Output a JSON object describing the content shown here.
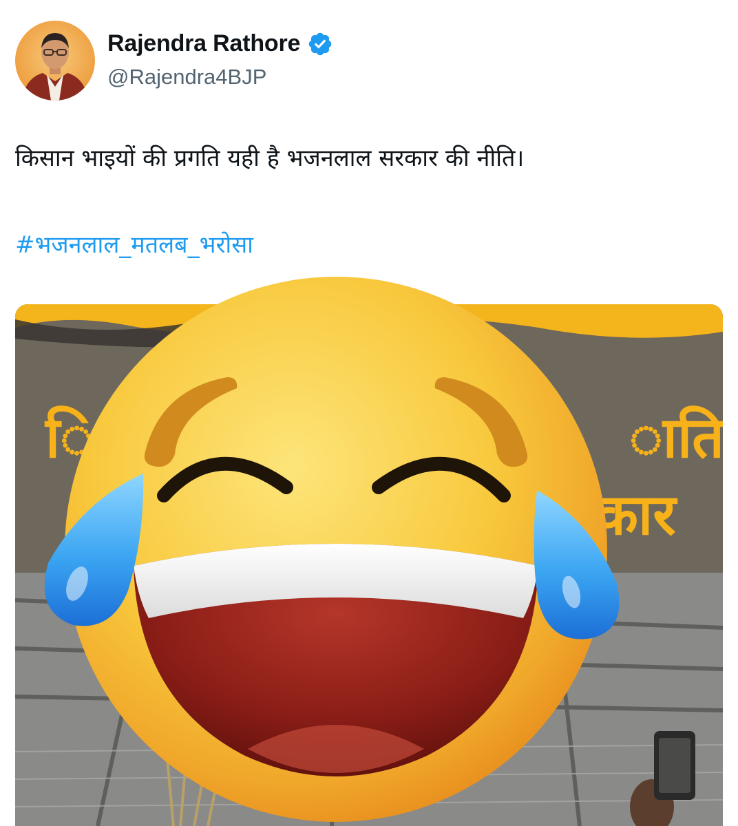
{
  "author": {
    "display_name": "Rajendra Rathore",
    "handle": "@Rajendra4BJP",
    "verified": true
  },
  "tweet": {
    "text": "किसान भाइयों की प्रगति यही है भजनलाल सरकार की नीति।",
    "hashtag": "#भजनलाल_मतलब_भरोसा"
  },
  "media": {
    "overlay_text_line1": "ाति",
    "overlay_text_line2": "कार",
    "emoji_icon": "face-with-tears-of-joy-icon"
  },
  "colors": {
    "link": "#1d9bf0",
    "verified_badge": "#1d9bf0",
    "secondary_text": "#536471",
    "media_background": "#6e675c",
    "banner_yellow": "#f7b21a"
  }
}
